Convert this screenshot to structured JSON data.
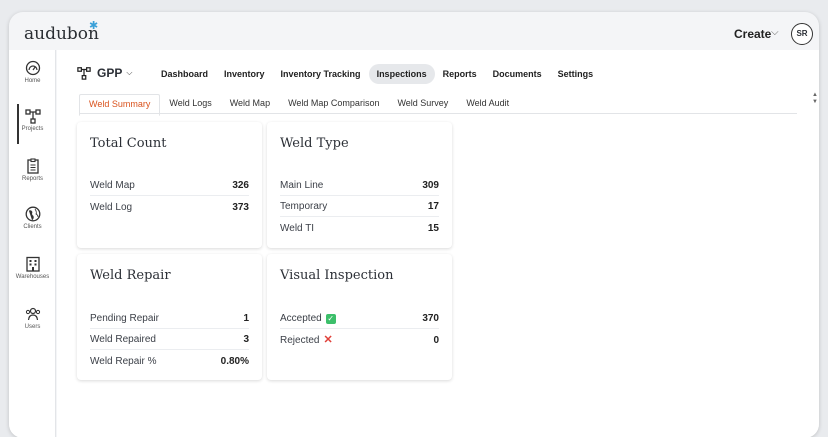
{
  "app": {
    "logo_text": "audubon",
    "create_label": "Create",
    "avatar_initials": "SR"
  },
  "sidebar": {
    "items": [
      {
        "label": "Home",
        "icon": "dashboard-gauge-icon"
      },
      {
        "label": "Projects",
        "icon": "project-hierarchy-icon"
      },
      {
        "label": "Reports",
        "icon": "clipboard-icon"
      },
      {
        "label": "Clients",
        "icon": "globe-icon"
      },
      {
        "label": "Warehouses",
        "icon": "building-icon"
      },
      {
        "label": "Users",
        "icon": "users-icon"
      }
    ]
  },
  "project": {
    "name": "GPP"
  },
  "main_tabs": [
    "Dashboard",
    "Inventory",
    "Inventory Tracking",
    "Inspections",
    "Reports",
    "Documents",
    "Settings"
  ],
  "sub_tabs": [
    "Weld Summary",
    "Weld Logs",
    "Weld Map",
    "Weld Map Comparison",
    "Weld Survey",
    "Weld Audit"
  ],
  "cards": {
    "total_count": {
      "title": "Total Count",
      "rows": [
        {
          "label": "Weld Map",
          "value": "326"
        },
        {
          "label": "Weld Log",
          "value": "373"
        }
      ]
    },
    "weld_type": {
      "title": "Weld Type",
      "rows": [
        {
          "label": "Main Line",
          "value": "309"
        },
        {
          "label": "Temporary",
          "value": "17"
        },
        {
          "label": "Weld TI",
          "value": "15"
        }
      ]
    },
    "weld_repair": {
      "title": "Weld Repair",
      "rows": [
        {
          "label": "Pending Repair",
          "value": "1"
        },
        {
          "label": "Weld Repaired",
          "value": "3"
        },
        {
          "label": "Weld Repair %",
          "value": "0.80%"
        }
      ]
    },
    "visual_inspection": {
      "title": "Visual Inspection",
      "rows": [
        {
          "label": "Accepted",
          "value": "370",
          "icon": "check-icon"
        },
        {
          "label": "Rejected",
          "value": "0",
          "icon": "x-icon"
        }
      ]
    }
  },
  "colors": {
    "accent_tab": "#d9531e",
    "accepted": "#3cbf6a",
    "rejected": "#e0413a"
  }
}
